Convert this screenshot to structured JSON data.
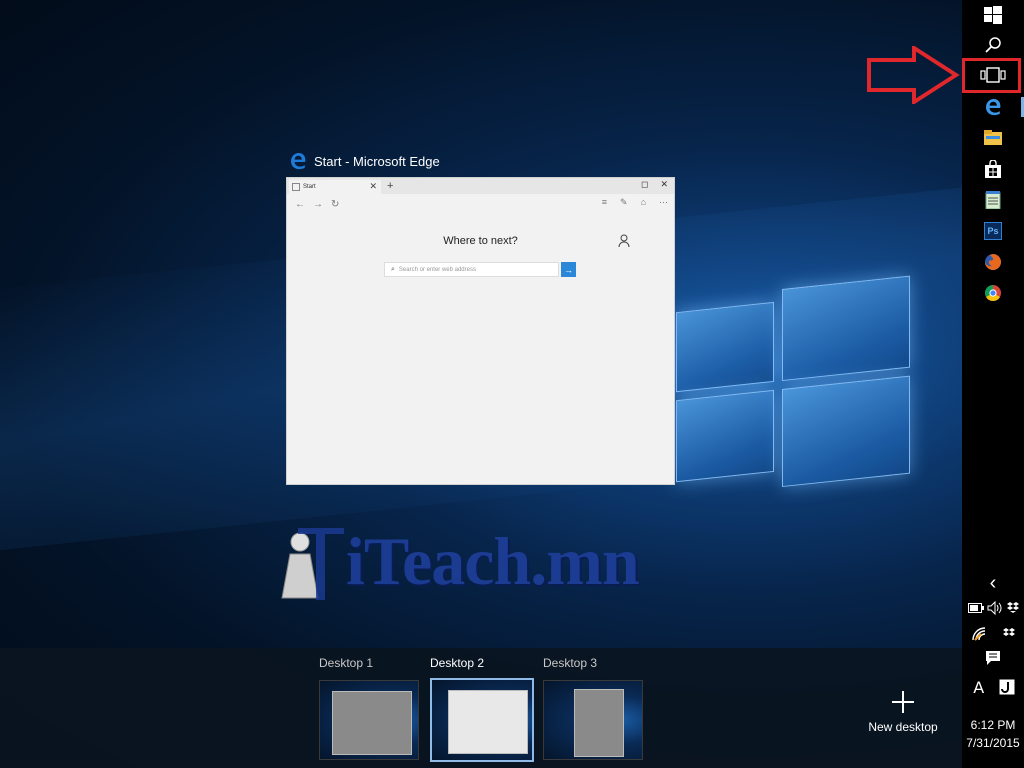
{
  "window_preview": {
    "title": "Start - Microsoft Edge",
    "tab_label": "Start",
    "tab_close": "✕",
    "new_tab": "+",
    "heading": "Where to next?",
    "search_placeholder": "Search or enter web address",
    "go_arrow": "→",
    "controls": {
      "minimize": "ㅡ",
      "maximize": "◻",
      "close": "✕"
    },
    "nav": {
      "back": "←",
      "forward": "→",
      "refresh": "↻"
    },
    "tools": [
      "≡",
      "✎",
      "⌂",
      "⋯"
    ]
  },
  "watermark": {
    "text": "iTeach.mn"
  },
  "desktops": [
    {
      "label": "Desktop 1",
      "active": false
    },
    {
      "label": "Desktop 2",
      "active": true
    },
    {
      "label": "Desktop 3",
      "active": false
    }
  ],
  "new_desktop_label": "New desktop",
  "taskbar": {
    "icons": [
      "windows-start-icon",
      "search-icon",
      "task-view-icon",
      "edge-icon",
      "file-explorer-icon",
      "store-icon",
      "notepad-icon",
      "photoshop-icon",
      "firefox-icon",
      "chrome-icon"
    ],
    "photoshop_label": "Ps",
    "edge_glyph": "e",
    "chevron": "‹",
    "tray_symbols": {
      "battery": "▭",
      "volume": "🔈",
      "dropbox": "❖",
      "wifi": "◢",
      "action_center": "▤",
      "ime": "A",
      "ime2": "J"
    }
  },
  "clock": {
    "time": "6:12 PM",
    "date": "7/31/2015"
  },
  "colors": {
    "highlight": "#e0272b",
    "taskbar": "#000000",
    "accent": "#2b88d8"
  }
}
